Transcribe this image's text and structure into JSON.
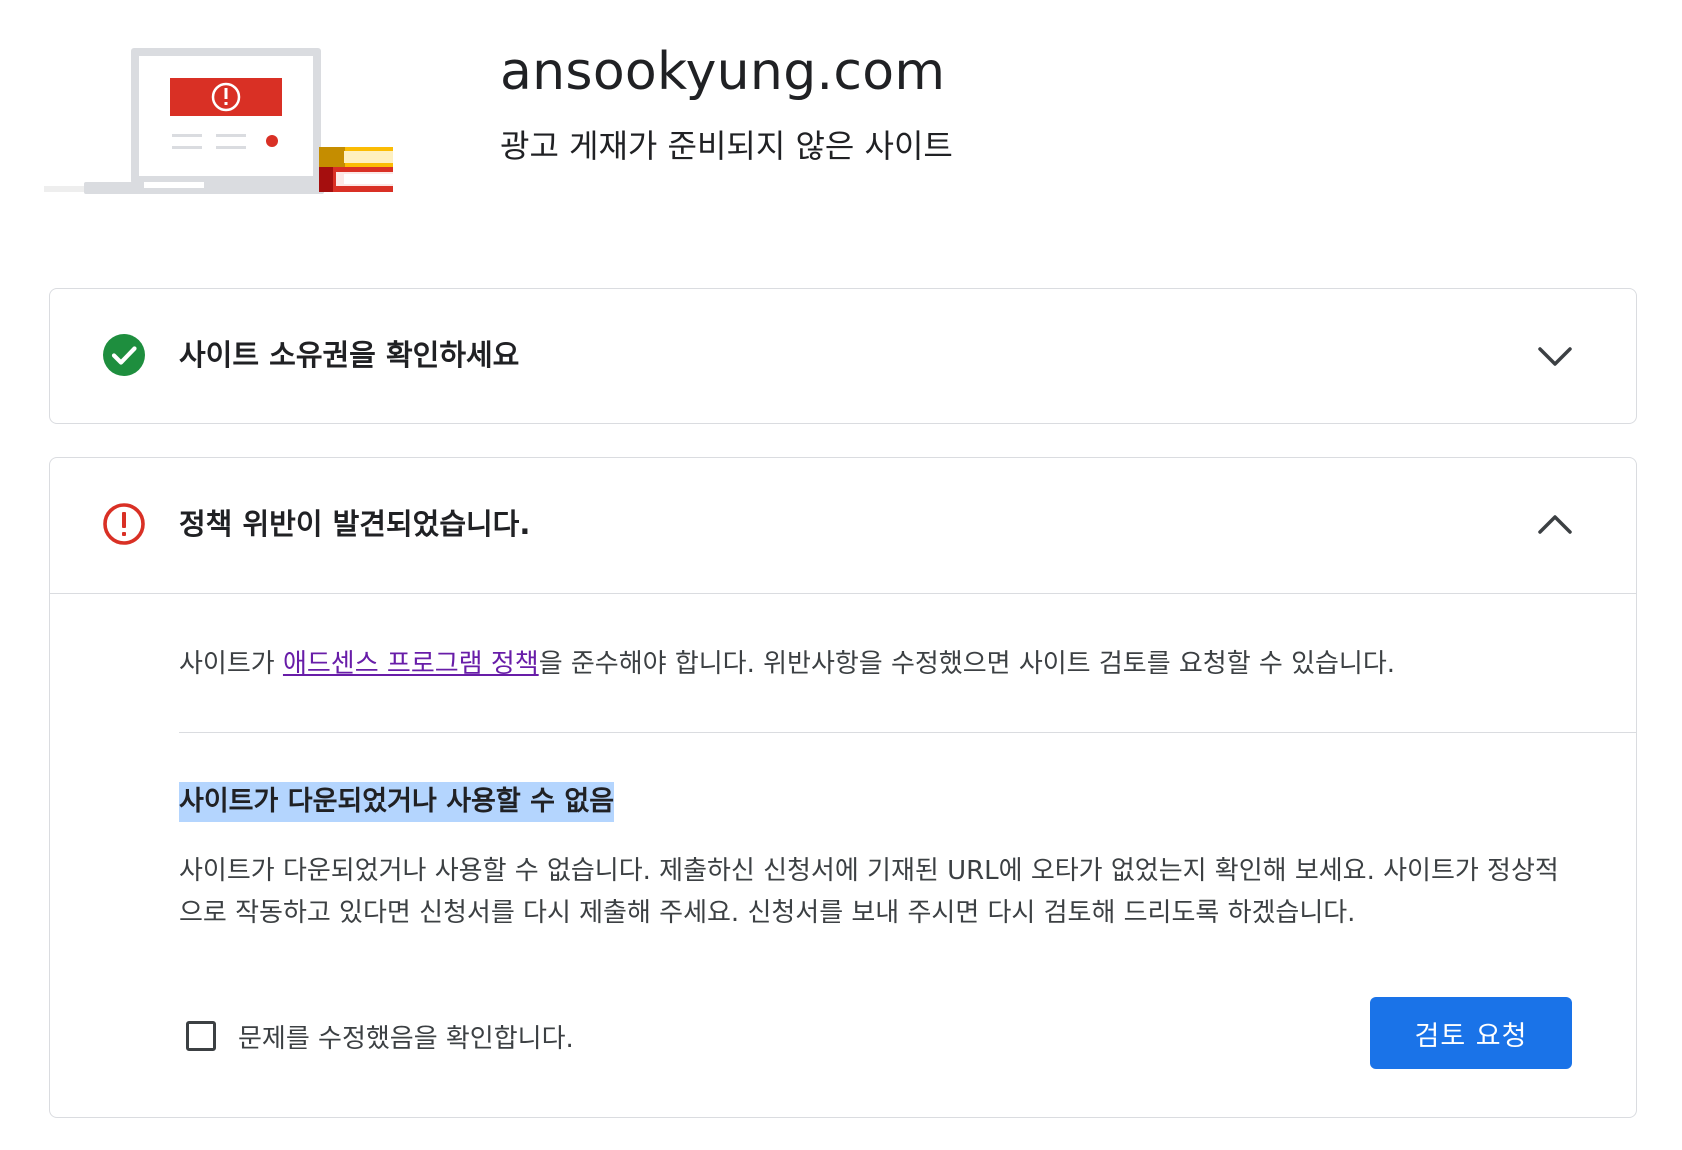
{
  "header": {
    "site_name": "ansookyung.com",
    "status_subtitle": "광고 게재가 준비되지 않은 사이트"
  },
  "ownership_card": {
    "title": "사이트 소유권을 확인하세요",
    "status": "complete",
    "expanded": false
  },
  "violation_card": {
    "title": "정책 위반이 발견되었습니다.",
    "status": "error",
    "expanded": true,
    "policy_prefix": "사이트가 ",
    "policy_link": "애드센스 프로그램 정책",
    "policy_suffix": "을 준수해야 합니다. 위반사항을 수정했으면 사이트 검토를 요청할 수 있습니다.",
    "issue_title": "사이트가 다운되었거나 사용할 수 없음",
    "issue_description": "사이트가 다운되었거나 사용할 수 없습니다. 제출하신 신청서에 기재된 URL에 오타가 없었는지 확인해 보세요. 사이트가 정상적으로 작동하고 있다면 신청서를 다시 제출해 주세요. 신청서를 보내 주시면 다시 검토해 드리도록 하겠습니다.",
    "confirm_label": "문제를 수정했음을 확인합니다.",
    "confirm_checked": false,
    "review_button": "검토 요청"
  },
  "colors": {
    "success": "#1e8e3e",
    "error": "#d93025",
    "primary": "#1a73e8",
    "link": "#681da8",
    "selection": "#b4d5fe"
  }
}
